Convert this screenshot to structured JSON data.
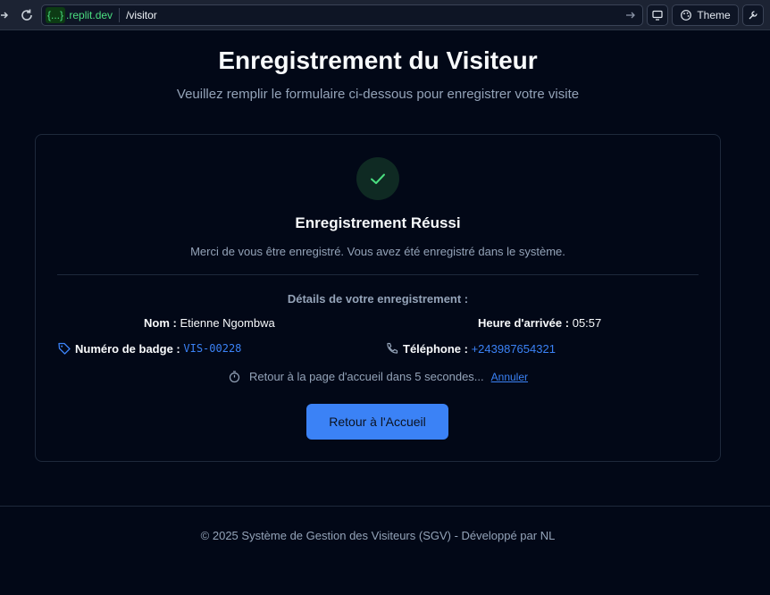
{
  "browser": {
    "host_badge": "{...}",
    "host_suffix": ".replit.dev",
    "path": "/visitor",
    "theme_label": "Theme"
  },
  "header": {
    "title": "Enregistrement du Visiteur",
    "subtitle": "Veuillez remplir le formulaire ci-dessous pour enregistrer votre visite"
  },
  "card": {
    "success_title": "Enregistrement Réussi",
    "success_message": "Merci de vous être enregistré. Vous avez été enregistré dans le système.",
    "details_heading": "Détails de votre enregistrement :",
    "name_label": "Nom :",
    "name_value": "Etienne Ngombwa",
    "arrival_label": "Heure d'arrivée :",
    "arrival_value": "05:57",
    "badge_label": "Numéro de badge :",
    "badge_value": "VIS-00228",
    "phone_label": "Téléphone :",
    "phone_value": "+243987654321",
    "countdown_text": "Retour à la page d'accueil dans 5 secondes...",
    "cancel_label": "Annuler",
    "home_button_label": "Retour à l'Accueil"
  },
  "footer": {
    "text": "© 2025 Système de Gestion des Visiteurs (SGV) - Développé par NL"
  },
  "colors": {
    "background": "#020817",
    "accent": "#3b82f6",
    "success": "#4ade80"
  }
}
